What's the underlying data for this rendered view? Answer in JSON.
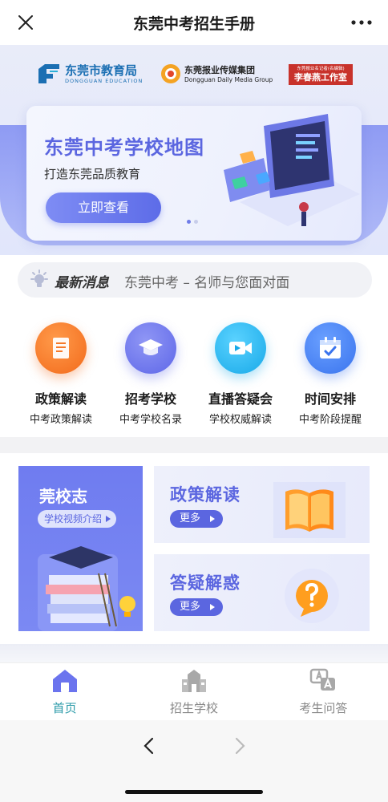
{
  "topbar": {
    "title": "东莞中考招生手册"
  },
  "logos": {
    "edu_cn": "东莞市教育局",
    "edu_en": "DONGGUAN EDUCATION",
    "media_cn": "东莞报业传媒集团",
    "media_en": "Dongguan Daily Media Group",
    "studio_small": "东莞报业名记者(名编辑)",
    "studio_big": "李春燕工作室"
  },
  "banner": {
    "title": "东莞中考学校地图",
    "subtitle": "打造东莞品质教育",
    "button": "立即查看"
  },
  "news": {
    "tag": "最新消息",
    "message": "东莞中考 – 名师与您面对面"
  },
  "entries": [
    {
      "title": "政策解读",
      "subtitle": "中考政策解读",
      "color": "#f7782a",
      "icon": "document-icon"
    },
    {
      "title": "招考学校",
      "subtitle": "中考学校名录",
      "color": "#6b74ee",
      "icon": "graduation-cap-icon"
    },
    {
      "title": "直播答疑会",
      "subtitle": "学校权威解读",
      "color": "#27b8ee",
      "icon": "video-icon"
    },
    {
      "title": "时间安排",
      "subtitle": "中考阶段提醒",
      "color": "#3f7df0",
      "icon": "calendar-icon"
    }
  ],
  "cards": {
    "left": {
      "title": "莞校志",
      "pill": "学校视频介绍"
    },
    "right": [
      {
        "title": "政策解读",
        "more": "更多"
      },
      {
        "title": "答疑解惑",
        "more": "更多"
      }
    ]
  },
  "tabs": [
    {
      "label": "首页",
      "icon": "home-icon",
      "active": true
    },
    {
      "label": "招生学校",
      "icon": "school-icon",
      "active": false
    },
    {
      "label": "考生问答",
      "icon": "qa-icon",
      "active": false
    }
  ],
  "colors": {
    "accent": "#5b66e0",
    "tab_active": "#2a9aa8",
    "studio_red": "#c8322b"
  }
}
